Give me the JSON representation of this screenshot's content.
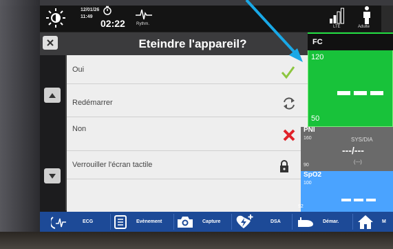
{
  "topbar": {
    "date": "12/01/26",
    "time": "11:49",
    "timer": "02:22",
    "rhythm_label": "Rythm.",
    "lte_label": "LTE",
    "patient_mode": "Adulte"
  },
  "dialog": {
    "title": "Eteindre l'appareil?",
    "options": [
      {
        "label": "Oui",
        "icon": "check-icon",
        "color": "#8cc63f"
      },
      {
        "label": "Redémarrer",
        "icon": "restart-icon",
        "color": "#555555"
      },
      {
        "label": "Non",
        "icon": "x-icon",
        "color": "#e0222a"
      },
      {
        "label": "Verrouiller l'écran tactile",
        "icon": "lock-icon",
        "color": "#333333"
      }
    ]
  },
  "vitals": {
    "fc": {
      "name": "FC",
      "high": "120",
      "low": "50",
      "color": "#18c23a"
    },
    "pni": {
      "name": "PNI",
      "high": "160",
      "low": "90",
      "label": "SYS/DIA",
      "value": "---/---",
      "sub": "(---)"
    },
    "spo2": {
      "name": "SpO2",
      "high": "100",
      "low": "92",
      "color": "#4aa3ff"
    }
  },
  "toolbar": {
    "items": [
      {
        "label": "ECG",
        "icon": "ecg-icon"
      },
      {
        "label": "Evènement",
        "icon": "event-list-icon"
      },
      {
        "label": "Capture",
        "icon": "camera-icon"
      },
      {
        "label": "DSA",
        "icon": "shock-icon"
      },
      {
        "label": "Démar.",
        "icon": "start-icon"
      },
      {
        "label": "M",
        "icon": "home-icon"
      }
    ]
  }
}
